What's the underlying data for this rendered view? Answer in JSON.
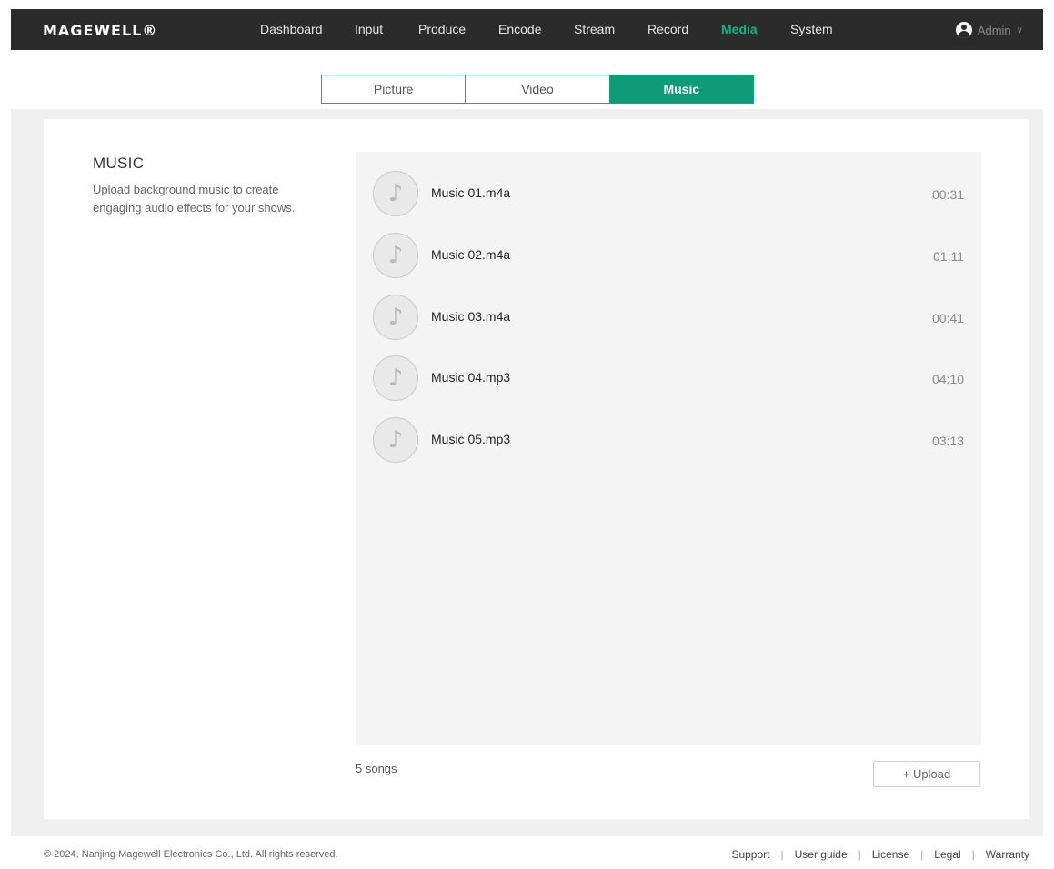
{
  "header": {
    "logo": "MAGEWELL®",
    "nav": [
      {
        "label": "Dashboard"
      },
      {
        "label": "Input"
      },
      {
        "label": "Produce"
      },
      {
        "label": "Encode"
      },
      {
        "label": "Stream"
      },
      {
        "label": "Record"
      },
      {
        "label": "Media"
      },
      {
        "label": "System"
      }
    ],
    "active_nav": "Media",
    "user": {
      "name": "Admin",
      "chevron": "∨"
    }
  },
  "tabs": [
    {
      "label": "Picture"
    },
    {
      "label": "Video"
    },
    {
      "label": "Music"
    }
  ],
  "active_tab": "Music",
  "section": {
    "title": "MUSIC",
    "description": "Upload background music to create engaging audio effects for your shows."
  },
  "music": {
    "icon": "music-note-icon",
    "glyph": "♪",
    "items": [
      {
        "name": "Music 01.m4a",
        "duration": "00:31"
      },
      {
        "name": "Music 02.m4a",
        "duration": "01:11"
      },
      {
        "name": "Music 03.m4a",
        "duration": "00:41"
      },
      {
        "name": "Music 04.mp3",
        "duration": "04:10"
      },
      {
        "name": "Music 05.mp3",
        "duration": "03:13"
      }
    ],
    "count_label": "5 songs",
    "upload_label": "+ Upload"
  },
  "footer": {
    "copyright": "© 2024, Nanjing Magewell Electronics Co., Ltd. All rights reserved.",
    "links": [
      {
        "label": "Support"
      },
      {
        "label": "User guide"
      },
      {
        "label": "License"
      },
      {
        "label": "Legal"
      },
      {
        "label": "Warranty"
      }
    ],
    "separator": "|"
  },
  "colors": {
    "accent": "#16b28a",
    "tab_active": "#0f9a78",
    "topbar": "#2b2b2b",
    "panel": "#f4f4f4"
  }
}
